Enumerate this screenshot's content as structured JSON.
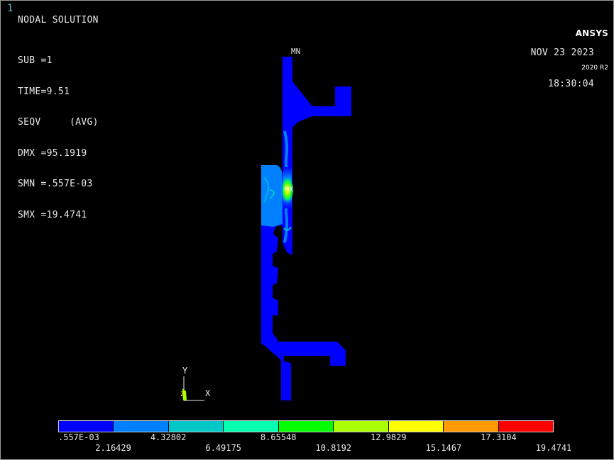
{
  "window_number": "1",
  "logo": {
    "brand": "ANSYS",
    "version": "2020 R2"
  },
  "title": "NODAL SOLUTION",
  "stats": {
    "sub": "SUB =1",
    "time": "TIME=9.51",
    "result": "SEQV     (AVG)",
    "dmx": "DMX =95.1919",
    "smn": "SMN =.557E-03",
    "smx": "SMX =19.4741"
  },
  "date": "NOV 23 2023",
  "time": "18:30:04",
  "markers": {
    "min": "MN",
    "max": "MX"
  },
  "axes": {
    "y": "Y",
    "x": "X",
    "z": "Z"
  },
  "legend": {
    "colors": [
      "#0000ff",
      "#0080ff",
      "#00c8c8",
      "#00ffb0",
      "#00ff00",
      "#aaff00",
      "#ffff00",
      "#ff9900",
      "#ff0000"
    ],
    "labels_top": [
      ".557E-03",
      "4.32802",
      "8.65548",
      "12.9829",
      "17.3104"
    ],
    "labels_bottom": [
      "2.16429",
      "6.49175",
      "10.8192",
      "15.1467",
      "19.4741"
    ]
  }
}
